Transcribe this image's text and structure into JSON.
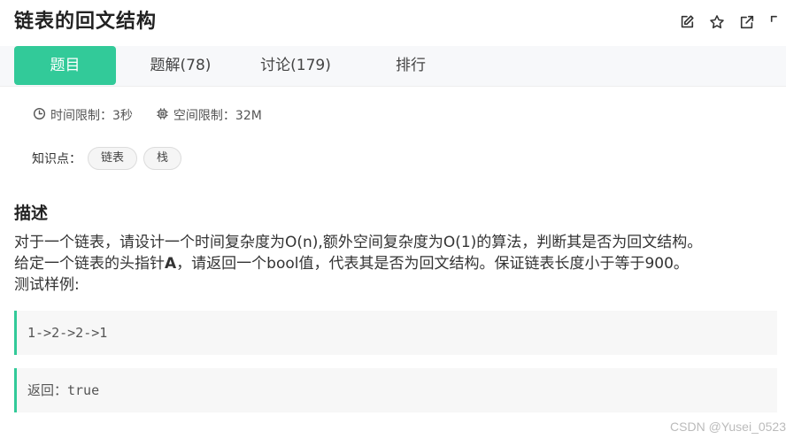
{
  "header": {
    "title": "链表的回文结构",
    "icons": [
      "edit-icon",
      "star-icon",
      "share-icon",
      "fullscreen-icon"
    ]
  },
  "tabs": [
    {
      "label": "题目",
      "active": true
    },
    {
      "label": "题解(78)",
      "active": false
    },
    {
      "label": "讨论(179)",
      "active": false
    },
    {
      "label": "排行",
      "active": false
    }
  ],
  "limits": {
    "time": "时间限制：3秒",
    "memory": "空间限制：32M"
  },
  "knowledge": {
    "label": "知识点：",
    "tags": [
      "链表",
      "栈"
    ]
  },
  "description": {
    "heading": "描述",
    "line1": "对于一个链表，请设计一个时间复杂度为O(n),额外空间复杂度为O(1)的算法，判断其是否为回文结构。",
    "line2_prefix": "给定一个链表的头指针",
    "line2_bold": "A",
    "line2_suffix": "，请返回一个bool值，代表其是否为回文结构。保证链表长度小于等于900。",
    "line3": "测试样例:"
  },
  "examples": {
    "input": "1->2->2->1",
    "output": "返回：true"
  },
  "watermark": "CSDN @Yusei_0523",
  "colors": {
    "accent": "#32ca99",
    "tabbar_bg": "#f7f8fa"
  }
}
